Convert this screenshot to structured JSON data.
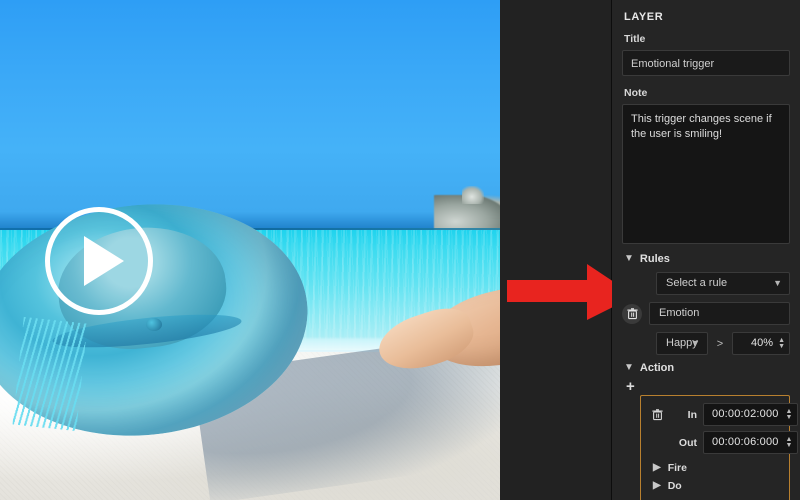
{
  "preview": {
    "name": "video-preview",
    "play_button": "play-icon",
    "scene_description": "Beach scene with blue straw sun hat on white sand, turquoise sea and rocky outcrop"
  },
  "annotation": {
    "arrow_color": "#e8241f",
    "arrow_points_to": "rule-select"
  },
  "panel": {
    "header": "LAYER",
    "title": {
      "label": "Title",
      "value": "Emotional trigger",
      "placeholder": "Title"
    },
    "note": {
      "label": "Note",
      "value": "This trigger changes scene if the user is smiling!",
      "placeholder": "Note"
    },
    "rules": {
      "section_label": "Rules",
      "select_rule": "Select a rule",
      "rule_name": "Emotion",
      "condition": {
        "emotion": "Happy",
        "operator": ">",
        "threshold": "40%"
      }
    },
    "action": {
      "section_label": "Action",
      "add_label": "+",
      "in_label": "In",
      "in_value": "00:00:02:000",
      "out_label": "Out",
      "out_value": "00:00:06:000",
      "fire_label": "Fire",
      "do_label": "Do",
      "highlight_color": "#b8802f"
    }
  }
}
